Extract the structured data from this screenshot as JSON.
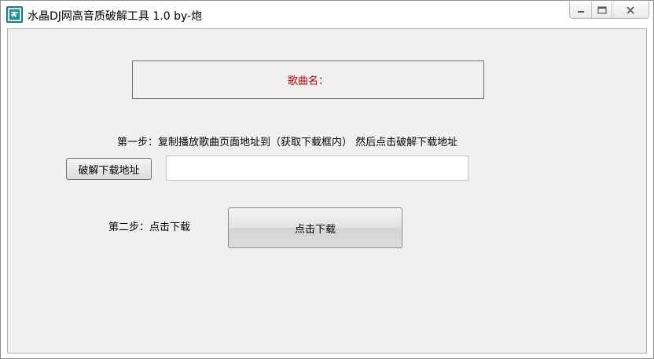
{
  "window": {
    "title": "水晶DJ网高音质破解工具  1.0    by-炮",
    "icon": "app-logo-icon"
  },
  "controls": {
    "minimize": "minimize-icon",
    "maximize": "maximize-icon",
    "close": "close-icon"
  },
  "song": {
    "label": "歌曲名："
  },
  "step1": {
    "instruction": "第一步：复制播放歌曲页面地址到（获取下载框内）  然后点击破解下载地址",
    "button_label": "破解下载地址",
    "input_value": "",
    "input_placeholder": ""
  },
  "step2": {
    "instruction": "第二步：点击下载",
    "button_label": "点击下载"
  },
  "colors": {
    "song_label": "#c00000",
    "client_bg": "#f0f0f0"
  }
}
